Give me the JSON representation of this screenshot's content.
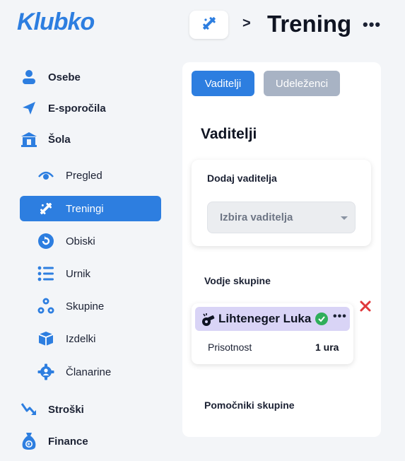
{
  "app": {
    "logo": "Klubko"
  },
  "header": {
    "separator": ">",
    "title": "Trening",
    "more": "•••",
    "crumb_icon": "sport-sticks-icon"
  },
  "sidebar": {
    "top": [
      {
        "label": "Osebe",
        "icon": "person-icon"
      },
      {
        "label": "E-sporočila",
        "icon": "send-icon"
      },
      {
        "label": "Šola",
        "icon": "school-icon"
      }
    ],
    "sub": [
      {
        "label": "Pregled",
        "icon": "eye-icon"
      },
      {
        "label": "Treningi",
        "icon": "sport-sticks-icon",
        "active": true
      },
      {
        "label": "Obiski",
        "icon": "refresh-circle-icon"
      },
      {
        "label": "Urnik",
        "icon": "list-icon"
      },
      {
        "label": "Skupine",
        "icon": "group-icon"
      },
      {
        "label": "Izdelki",
        "icon": "box-icon"
      },
      {
        "label": "Članarine",
        "icon": "badge-gear-icon"
      }
    ],
    "bottom": [
      {
        "label": "Stroški",
        "icon": "trend-down-icon"
      },
      {
        "label": "Finance",
        "icon": "money-bag-icon"
      }
    ]
  },
  "tabs": {
    "active": "Vaditelji",
    "inactive": "Udeleženci"
  },
  "section_title": "Vaditelji",
  "add_coach": {
    "title": "Dodaj vaditelja",
    "select_value": "Izbira vaditelja"
  },
  "leaders": {
    "title": "Vodje skupine",
    "items": [
      {
        "name": "Lihteneger Luka",
        "more": "•••",
        "stat_label": "Prisotnost",
        "stat_value": "1 ura"
      }
    ]
  },
  "assistants": {
    "title": "Pomočniki skupine"
  },
  "colors": {
    "accent": "#2d7ee0",
    "inactive_tab": "#a8b3c4",
    "leader_head": "#d9d4f6",
    "remove": "#e0383b",
    "check": "#2fae5a"
  }
}
